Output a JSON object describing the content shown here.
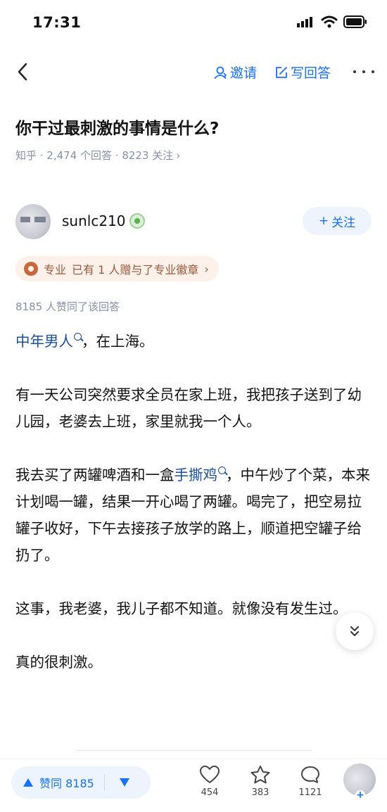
{
  "status_bar": {
    "time": "17:31"
  },
  "nav": {
    "invite_label": "邀请",
    "write_answer_label": "写回答"
  },
  "question": {
    "title": "你干过最刺激的事情是什么?",
    "meta": "知乎 · 2,474 个回答 · 8223 关注",
    "meta_chevron": "›"
  },
  "author": {
    "name": "sunlc210",
    "follow_label": "关注",
    "follow_plus": "+",
    "pro_tag_label": "专业",
    "pro_tag_text": "已有 1 人赠与了专业徽章",
    "pro_tag_chevron": "›"
  },
  "answer": {
    "agree_note": "8185 人赞同了该回答",
    "p1_link": "中年男人",
    "p1_rest": "，在上海。",
    "p2": "有一天公司突然要求全员在家上班，我把孩子送到了幼儿园，老婆去上班，家里就我一个人。",
    "p3_before": "我去买了两罐啤酒和一盒",
    "p3_link": "手撕鸡",
    "p3_after": "，中午炒了个菜，本来计划喝一罐，结果一开心喝了两罐。喝完了，把空易拉罐子收好，下午去接孩子放学的路上，顺道把空罐子给扔了。",
    "p4": "这事，我老婆，我儿子都不知道。就像没有发生过。",
    "p5": "真的很刺激。"
  },
  "bottom_bar": {
    "agree_label": "赞同 8185",
    "like_count": "454",
    "fav_count": "383",
    "comment_count": "1121",
    "avatar_plus": "+"
  },
  "colors": {
    "accent": "#1772f6",
    "link": "#1a4f9c",
    "meta": "#8590a6",
    "pro_tag_bg": "#fdf1ea",
    "pro_tag_text": "#9b5a3e"
  },
  "icons": {
    "status": [
      "signal-icon",
      "wifi-icon",
      "battery-icon"
    ],
    "nav": [
      "back-arrow-icon",
      "person-icon",
      "edit-icon",
      "more-icon"
    ],
    "bottom": [
      "upvote-icon",
      "downvote-icon",
      "heart-icon",
      "star-icon",
      "comment-icon"
    ]
  }
}
